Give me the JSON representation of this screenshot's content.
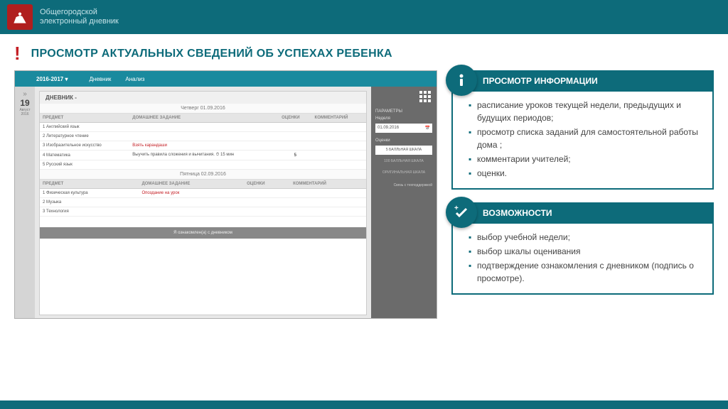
{
  "header": {
    "line1": "Общегородской",
    "line2": "электронный дневник"
  },
  "pageTitle": "ПРОСМОТР АКТУАЛЬНЫХ СВЕДЕНИЙ ОБ УСПЕХАХ РЕБЕНКА",
  "screenshot": {
    "year": "2016-2017 ▾",
    "nav": [
      "Дневник",
      "Анализ"
    ],
    "diaryLabel": "ДНЕВНИК -",
    "dateNum": "19",
    "dateMon": "Август",
    "dateYear": "2016",
    "cols": [
      "ПРЕДМЕТ",
      "ДОМАШНЕЕ ЗАДАНИЕ",
      "ОЦЕНКИ",
      "КОММЕНТАРИЙ"
    ],
    "day1": "Четверг  01.09.2016",
    "rows1": [
      {
        "n": "1",
        "subj": "Английский язык",
        "hw": "",
        "grade": "",
        "com": ""
      },
      {
        "n": "2",
        "subj": "Литературное чтение",
        "hw": "",
        "grade": "",
        "com": ""
      },
      {
        "n": "3",
        "subj": "Изобразительное искусство",
        "hw": "Взять карандаши",
        "grade": "",
        "com": "",
        "red": true
      },
      {
        "n": "4",
        "subj": "Математика",
        "hw": "Выучить правила сложения и вычитания.",
        "time": "⏱ 15 мин",
        "grade": "5",
        "com": ""
      },
      {
        "n": "5",
        "subj": "Русский язык",
        "hw": "",
        "grade": "",
        "com": ""
      }
    ],
    "day2": "Пятница  02.09.2016",
    "rows2": [
      {
        "n": "1",
        "subj": "Физическая культура",
        "hw": "Опоздание на урок",
        "grade": "",
        "com": "",
        "red": true
      },
      {
        "n": "2",
        "subj": "Музыка",
        "hw": "",
        "grade": "",
        "com": ""
      },
      {
        "n": "3",
        "subj": "Технология",
        "hw": "",
        "grade": "",
        "com": ""
      }
    ],
    "paramsLabel": "ПАРАМЕТРЫ",
    "weekLabel": "Неделя",
    "weekDate": "01.09.2016",
    "gradesLabel": "Оценки",
    "scale5": "5 БАЛЛЬНАЯ ШКАЛА",
    "scale100": "100 БАЛЛЬНАЯ ШКАЛА",
    "scaleOrig": "ОРИГИНАЛЬНАЯ ШКАЛА",
    "support": "Связь с техподдержкой",
    "confirmBtn": "Я ознакомлен(а) с дневником"
  },
  "block1": {
    "title": "ПРОСМОТР ИНФОРМАЦИИ",
    "items": [
      "расписание уроков  текущей недели, предыдущих и будущих периодов;",
      "просмотр списка заданий для самостоятельной работы дома ;",
      "комментарии учителей;",
      "оценки."
    ]
  },
  "block2": {
    "title": "ВОЗМОЖНОСТИ",
    "items": [
      "выбор учебной недели;",
      "выбор шкалы оценивания",
      "подтверждение  ознакомления с дневником (подпись о просмотре)."
    ]
  }
}
